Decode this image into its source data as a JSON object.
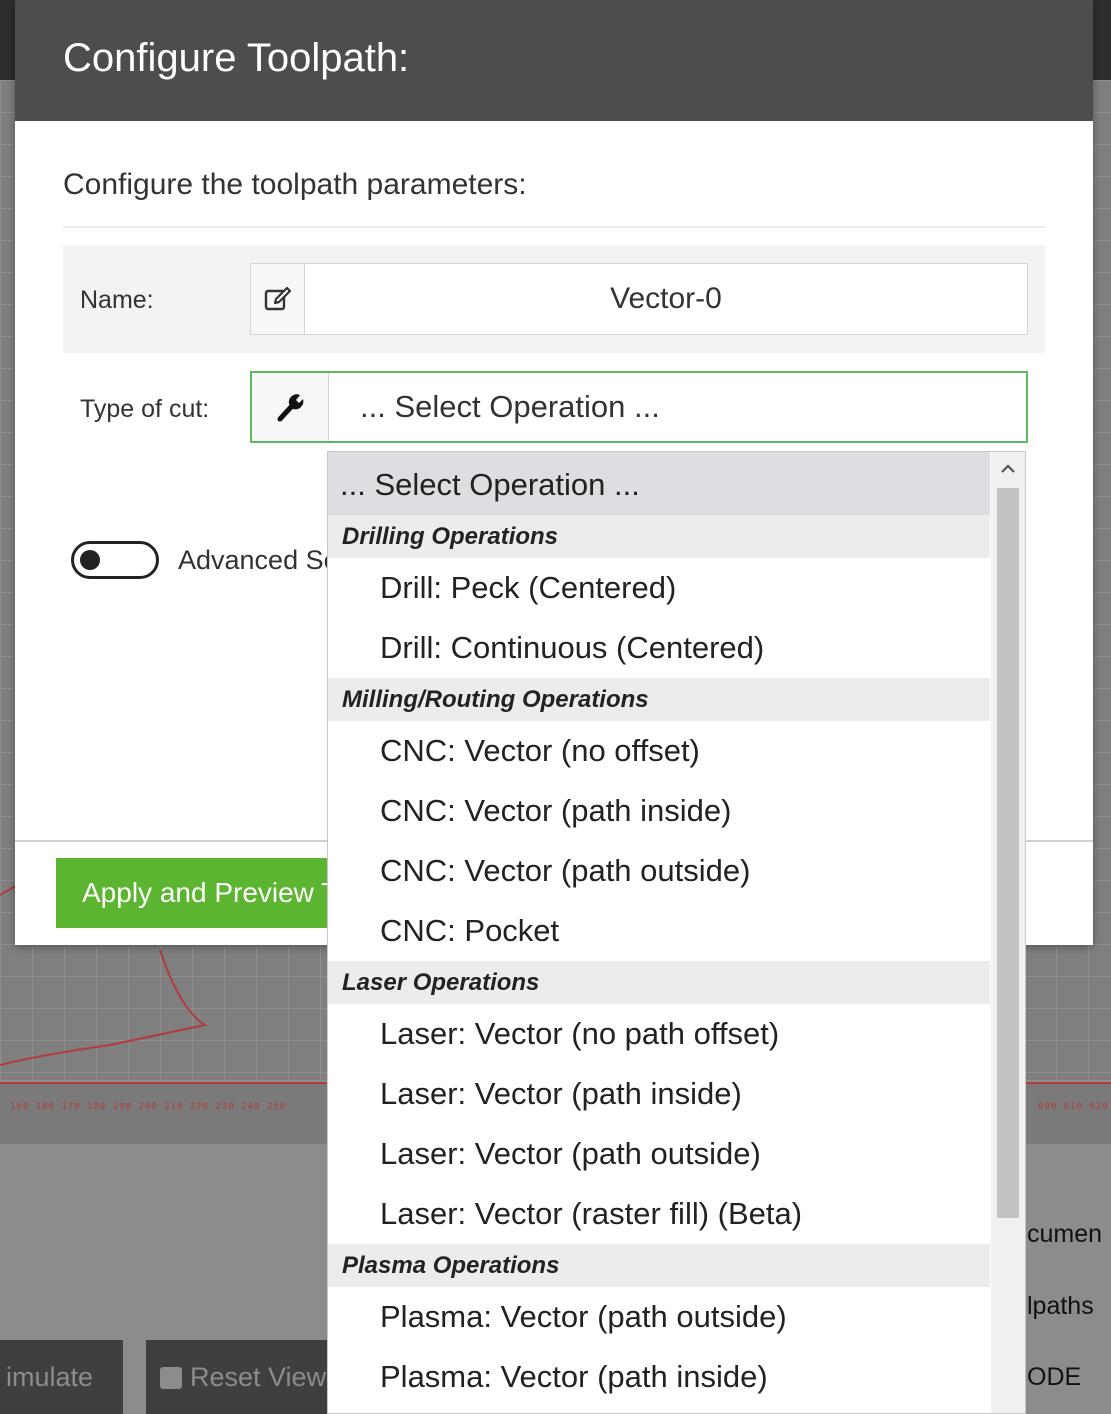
{
  "background": {
    "simulate_label": "imulate",
    "reset_view_label": "Reset View",
    "gcode_label": "ODE",
    "documents_label": "cumen",
    "toolpaths_label": "lpaths",
    "ruler_ticks_left": "160 180 170 180 190 200 210 220 230 240 250",
    "ruler_ticks_right": "600 610 620"
  },
  "modal": {
    "title": "Configure Toolpath:",
    "subtitle": "Configure the toolpath parameters:",
    "name_label": "Name:",
    "name_icon": "edit-icon",
    "name_value": "Vector-0",
    "type_label": "Type of cut:",
    "type_icon": "wrench-icon",
    "type_value": "... Select Operation ...",
    "advanced_label": "Advanced Se",
    "apply_button": "Apply and Preview T"
  },
  "dropdown": {
    "selected": "... Select Operation ...",
    "groups": [
      {
        "label": "Drilling Operations",
        "items": [
          "Drill: Peck (Centered)",
          "Drill: Continuous (Centered)"
        ]
      },
      {
        "label": "Milling/Routing Operations",
        "items": [
          "CNC: Vector (no offset)",
          "CNC: Vector (path inside)",
          "CNC: Vector (path outside)",
          "CNC: Pocket"
        ]
      },
      {
        "label": "Laser Operations",
        "items": [
          "Laser: Vector (no path offset)",
          "Laser: Vector (path inside)",
          "Laser: Vector (path outside)",
          "Laser: Vector (raster fill) (Beta)"
        ]
      },
      {
        "label": "Plasma Operations",
        "items": [
          "Plasma: Vector (path outside)",
          "Plasma: Vector (path inside)"
        ]
      }
    ]
  },
  "colors": {
    "header_bg": "#4d4d4d",
    "accent_green": "#5cb531",
    "focus_border": "#5cb85c",
    "drawing_red": "#b23b3b"
  }
}
